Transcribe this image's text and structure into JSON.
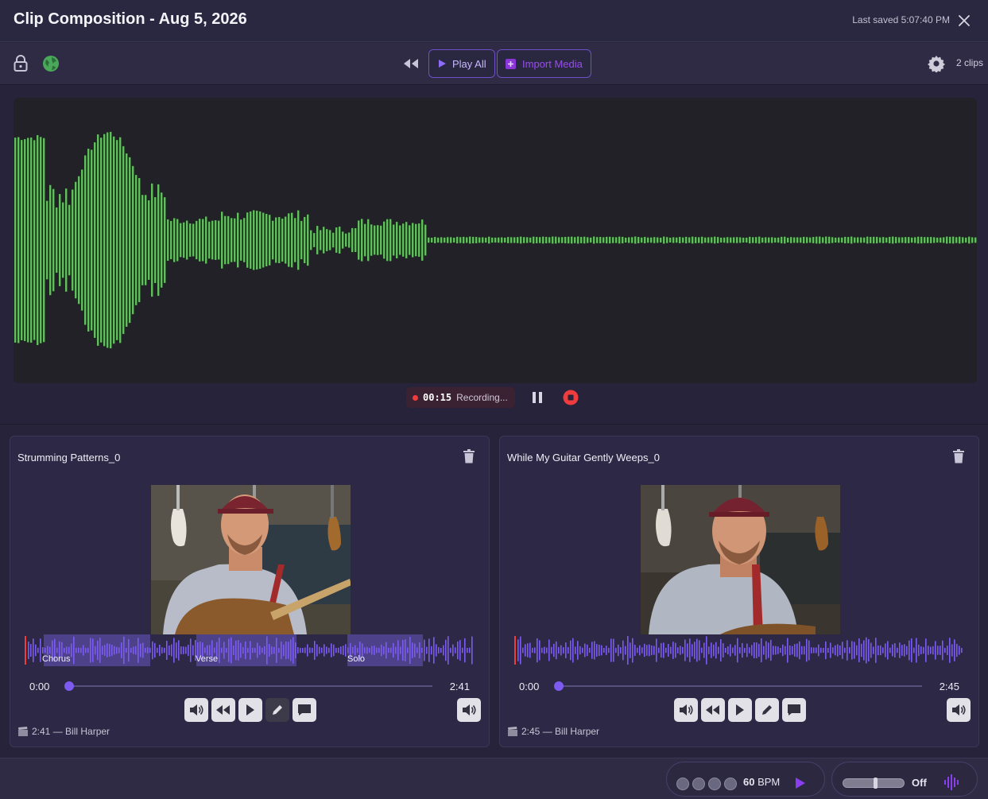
{
  "window": {
    "title": "Clip Composition - Aug 5, 2026",
    "last_saved": "Last saved 5:07:40 PM"
  },
  "toolbar": {
    "play_all_label": "Play All",
    "import_media_label": "Import Media",
    "clip_count": "2 clips"
  },
  "recorder": {
    "elapsed": "00:15",
    "status": "Recording...",
    "waveform_color": "#5fbf5a"
  },
  "clips": [
    {
      "title": "Strumming Patterns_0",
      "current_time": "0:00",
      "duration": "2:41",
      "progress": 0,
      "meta_text": "2:41 — Bill Harper",
      "sections": [
        "Chorus",
        "Verse",
        "Solo"
      ]
    },
    {
      "title": "While My Guitar Gently Weeps_0",
      "current_time": "0:00",
      "duration": "2:45",
      "progress": 0,
      "meta_text": "2:45 — Bill Harper",
      "sections": []
    }
  ],
  "bottom": {
    "bpm_value": "60",
    "bpm_unit": "BPM",
    "mix_state": "Off"
  },
  "colors": {
    "accent": "#7d5bf0",
    "wave_clip": "#7b5cf2",
    "record_red": "#f03c3c"
  }
}
